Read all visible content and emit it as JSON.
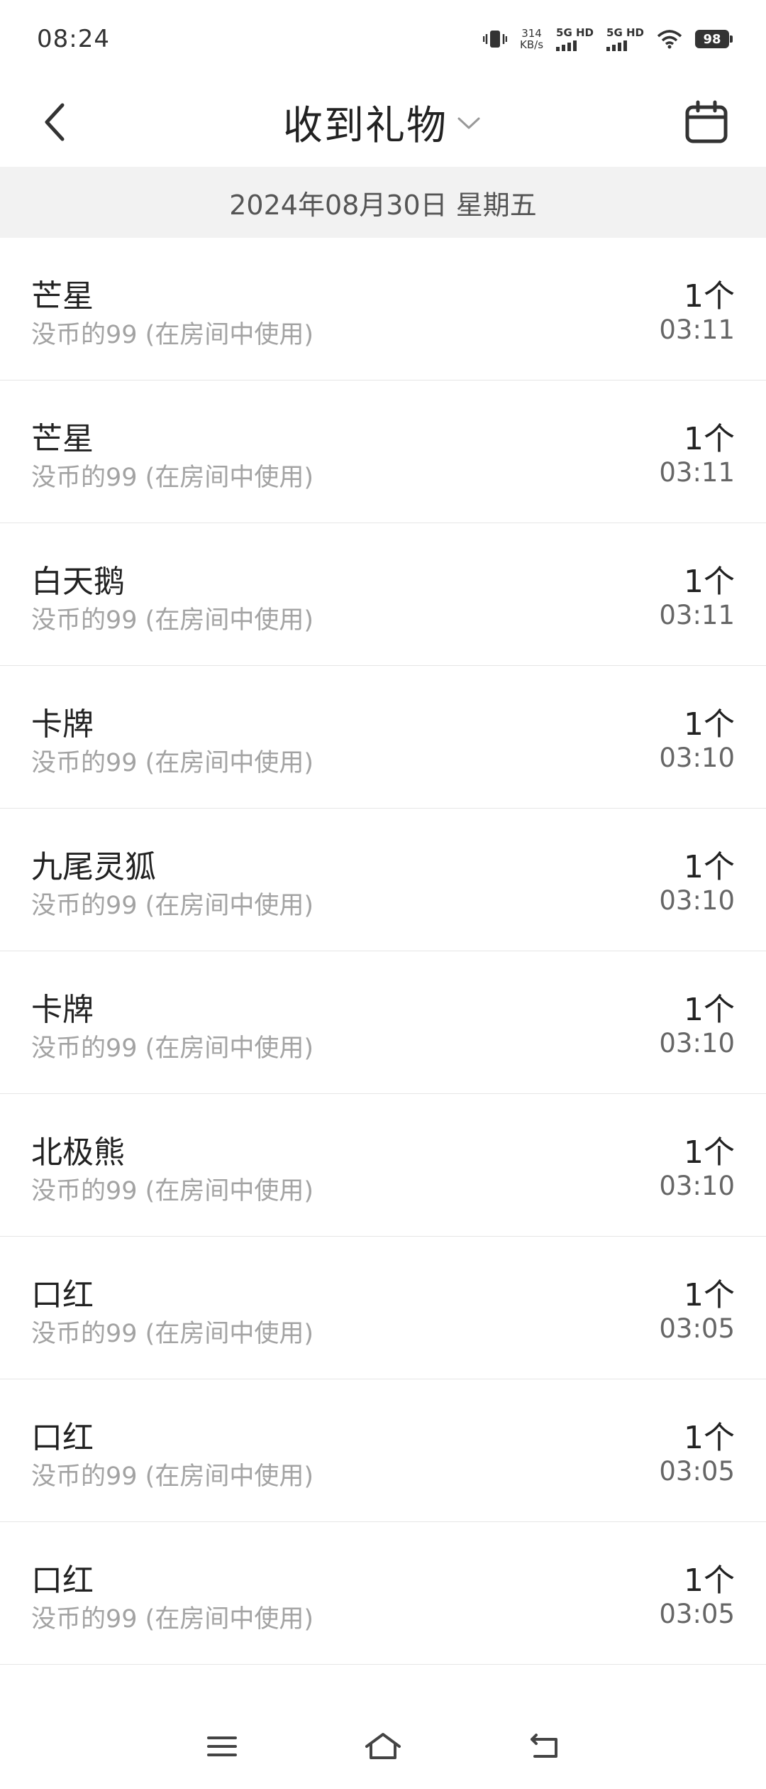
{
  "status": {
    "time": "08:24",
    "net_speed_value": "314",
    "net_speed_unit": "KB/s",
    "sim1": "5G HD",
    "sim2": "5G HD",
    "battery": "98"
  },
  "header": {
    "title": "收到礼物"
  },
  "date_label": "2024年08月30日 星期五",
  "gifts": [
    {
      "name": "芒星",
      "source": "没币的99 (在房间中使用)",
      "count": "1个",
      "time": "03:11"
    },
    {
      "name": "芒星",
      "source": "没币的99 (在房间中使用)",
      "count": "1个",
      "time": "03:11"
    },
    {
      "name": "白天鹅",
      "source": "没币的99 (在房间中使用)",
      "count": "1个",
      "time": "03:11"
    },
    {
      "name": "卡牌",
      "source": "没币的99 (在房间中使用)",
      "count": "1个",
      "time": "03:10"
    },
    {
      "name": "九尾灵狐",
      "source": "没币的99 (在房间中使用)",
      "count": "1个",
      "time": "03:10"
    },
    {
      "name": "卡牌",
      "source": "没币的99 (在房间中使用)",
      "count": "1个",
      "time": "03:10"
    },
    {
      "name": "北极熊",
      "source": "没币的99 (在房间中使用)",
      "count": "1个",
      "time": "03:10"
    },
    {
      "name": "口红",
      "source": "没币的99 (在房间中使用)",
      "count": "1个",
      "time": "03:05"
    },
    {
      "name": "口红",
      "source": "没币的99 (在房间中使用)",
      "count": "1个",
      "time": "03:05"
    },
    {
      "name": "口红",
      "source": "没币的99 (在房间中使用)",
      "count": "1个",
      "time": "03:05"
    }
  ],
  "icons": {
    "back": "back-chevron-icon",
    "title_dropdown": "chevron-down-icon",
    "calendar": "calendar-icon",
    "nav_menu": "menu-icon",
    "nav_home": "home-icon",
    "nav_back": "return-icon"
  },
  "colors": {
    "date_bar_bg": "#f2f2f2",
    "secondary_text": "#a3a3a3",
    "time_text": "#666666"
  }
}
